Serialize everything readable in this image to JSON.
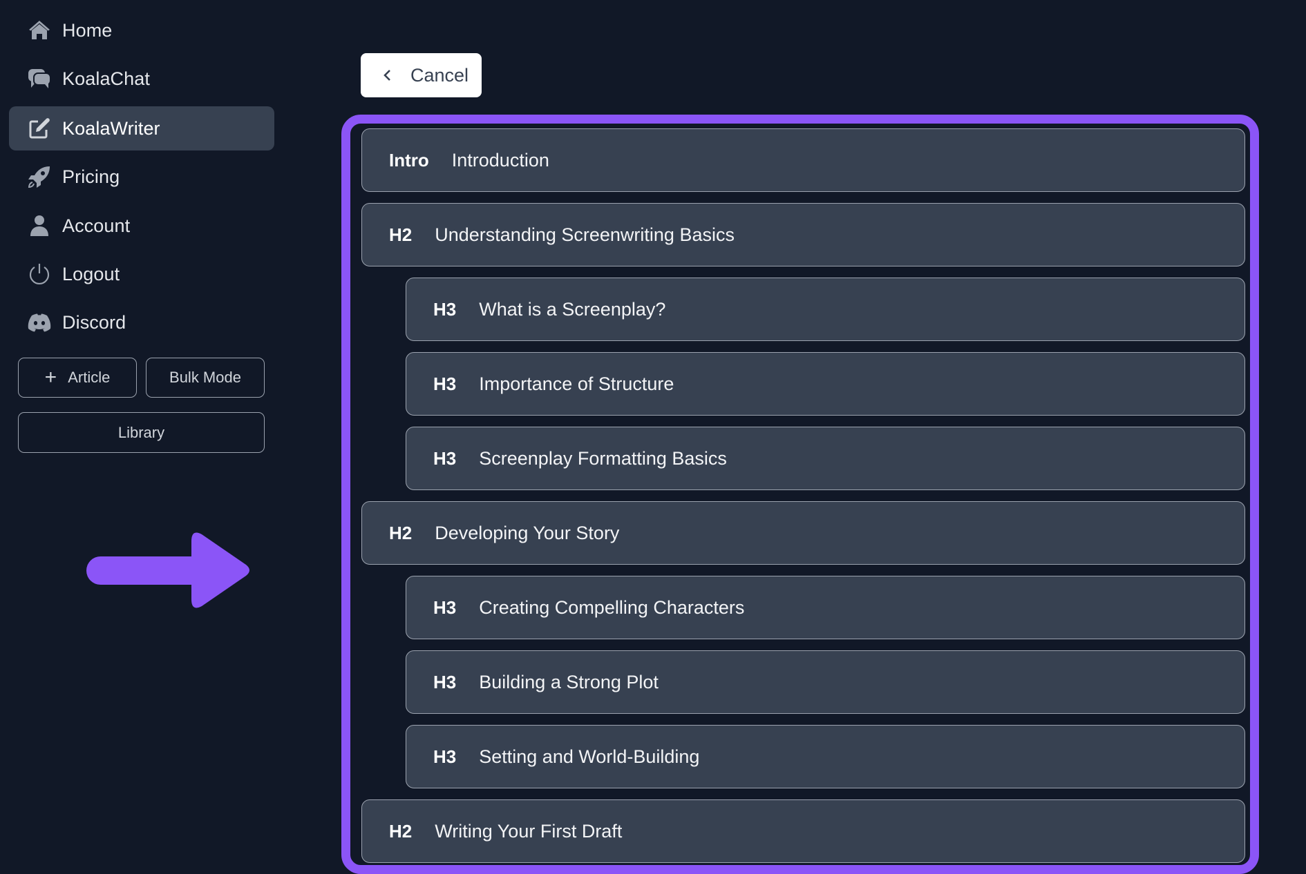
{
  "sidebar": {
    "nav": [
      {
        "label": "Home",
        "icon": "home-icon",
        "active": false
      },
      {
        "label": "KoalaChat",
        "icon": "chat-icon",
        "active": false
      },
      {
        "label": "KoalaWriter",
        "icon": "edit-icon",
        "active": true
      },
      {
        "label": "Pricing",
        "icon": "rocket-icon",
        "active": false
      },
      {
        "label": "Account",
        "icon": "user-icon",
        "active": false
      },
      {
        "label": "Logout",
        "icon": "power-icon",
        "active": false
      },
      {
        "label": "Discord",
        "icon": "discord-icon",
        "active": false
      }
    ],
    "buttons": {
      "article": "Article",
      "bulk_mode": "Bulk Mode",
      "library": "Library"
    }
  },
  "main": {
    "cancel_label": "Cancel",
    "accent_color": "#8b55f7",
    "outline": [
      {
        "tag": "Intro",
        "title": "Introduction",
        "level": 1
      },
      {
        "tag": "H2",
        "title": "Understanding Screenwriting Basics",
        "level": 2
      },
      {
        "tag": "H3",
        "title": "What is a Screenplay?",
        "level": 3
      },
      {
        "tag": "H3",
        "title": "Importance of Structure",
        "level": 3
      },
      {
        "tag": "H3",
        "title": "Screenplay Formatting Basics",
        "level": 3
      },
      {
        "tag": "H2",
        "title": "Developing Your Story",
        "level": 2
      },
      {
        "tag": "H3",
        "title": "Creating Compelling Characters",
        "level": 3
      },
      {
        "tag": "H3",
        "title": "Building a Strong Plot",
        "level": 3
      },
      {
        "tag": "H3",
        "title": "Setting and World-Building",
        "level": 3
      },
      {
        "tag": "H2",
        "title": "Writing Your First Draft",
        "level": 2
      }
    ]
  }
}
